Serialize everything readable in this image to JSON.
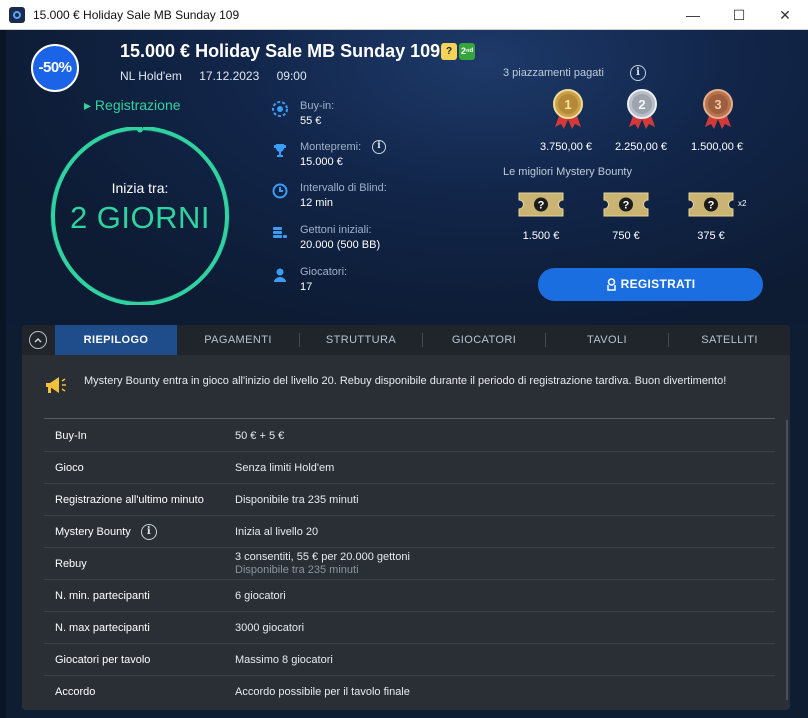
{
  "window": {
    "title": "15.000 € Holiday Sale MB Sunday 109",
    "minimize": "—",
    "maximize": "☐",
    "close": "✕"
  },
  "header": {
    "discount": "-50%",
    "title": "15.000 € Holiday Sale MB Sunday 109",
    "badge_q": "?",
    "badge_two": "2ⁿᵈ",
    "game": "NL Hold'em",
    "date": "17.12.2023",
    "time": "09:00"
  },
  "status": {
    "registration_link": "▸ Registrazione",
    "countdown_label": "Inizia tra:",
    "countdown_value": "2 GIORNI",
    "ring_progress": 0.99
  },
  "info": [
    {
      "label": "Buy-in:",
      "value": "55 €",
      "icon": "chip-icon"
    },
    {
      "label": "Montepremi:",
      "value": "15.000 €",
      "icon": "trophy-icon"
    },
    {
      "label": "Intervallo di Blind:",
      "value": "12 min",
      "icon": "clock-icon"
    },
    {
      "label": "Gettoni iniziali:",
      "value": "20.000 (500 BB)",
      "icon": "chip-stack-icon"
    },
    {
      "label": "Giocatori:",
      "value": "17",
      "icon": "player-icon"
    }
  ],
  "prizes": {
    "label": "3 piazzamenti pagati",
    "places": [
      {
        "rank": "1",
        "amount": "3.750,00 €",
        "color": "#c9a14a"
      },
      {
        "rank": "2",
        "amount": "2.250,00 €",
        "color": "#b9bec6"
      },
      {
        "rank": "3",
        "amount": "1.500,00 €",
        "color": "#b8744f"
      }
    ]
  },
  "bounty": {
    "label": "Le migliori Mystery Bounty",
    "items": [
      {
        "amount": "1.500 €"
      },
      {
        "amount": "750 €"
      },
      {
        "amount": "375 €"
      }
    ],
    "multiplier": "x2"
  },
  "register_button": "REGISTRATI",
  "tabs": [
    "RIEPILOGO",
    "PAGAMENTI",
    "STRUTTURA",
    "GIOCATORI",
    "TAVOLI",
    "SATELLITI"
  ],
  "active_tab": "RIEPILOGO",
  "notice": "Mystery Bounty entra in gioco all'inizio del livello 20. Rebuy disponibile durante il periodo di registrazione tardiva. Buon divertimento!",
  "summary": [
    {
      "key": "Buy-In",
      "value": "50 € + 5 €"
    },
    {
      "key": "Gioco",
      "value": "Senza limiti Hold'em"
    },
    {
      "key": "Registrazione all'ultimo minuto",
      "value": "Disponibile tra 235 minuti"
    },
    {
      "key": "Mystery Bounty",
      "value": "Inizia al livello 20",
      "info": "i"
    },
    {
      "key": "Rebuy",
      "value": "3 consentiti, 55 € per 20.000 gettoni",
      "sub": "Disponibile tra 235 minuti"
    },
    {
      "key": "N. min. partecipanti",
      "value": "6 giocatori"
    },
    {
      "key": "N. max partecipanti",
      "value": "3000 giocatori"
    },
    {
      "key": "Giocatori per tavolo",
      "value": "Massimo 8 giocatori"
    },
    {
      "key": "Accordo",
      "value": "Accordo possibile per il tavolo finale"
    }
  ]
}
